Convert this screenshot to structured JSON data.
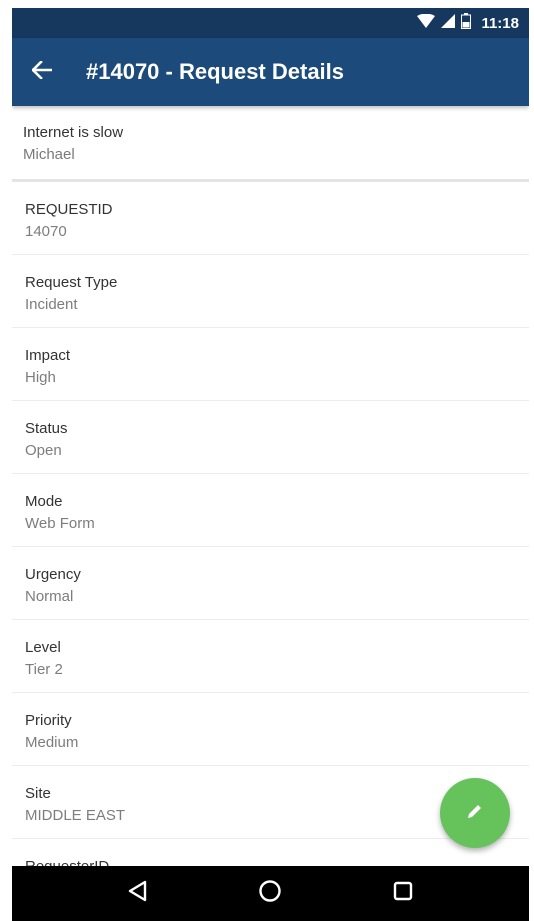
{
  "status_bar": {
    "time": "11:18",
    "icons": [
      "wifi-icon",
      "signal-icon",
      "battery-icon"
    ]
  },
  "app_bar": {
    "title": "#14070 - Request Details",
    "back_icon": "arrow-left-icon"
  },
  "summary": {
    "subject": "Internet is slow",
    "requester": "Michael"
  },
  "fields": [
    {
      "label": "REQUESTID",
      "value": "14070"
    },
    {
      "label": "Request Type",
      "value": "Incident"
    },
    {
      "label": "Impact",
      "value": "High"
    },
    {
      "label": "Status",
      "value": "Open"
    },
    {
      "label": "Mode",
      "value": "Web Form"
    },
    {
      "label": "Urgency",
      "value": "Normal"
    },
    {
      "label": "Level",
      "value": "Tier 2"
    },
    {
      "label": "Priority",
      "value": "Medium"
    },
    {
      "label": "Site",
      "value": "MIDDLE EAST"
    },
    {
      "label": "RequesterID",
      "value": ""
    }
  ],
  "fab": {
    "icon": "pencil-icon"
  },
  "nav_bar": {
    "icons": [
      "back-triangle-icon",
      "home-circle-icon",
      "recents-square-icon"
    ]
  },
  "colors": {
    "status_bar": "#16385f",
    "app_bar": "#1c4a7a",
    "fab": "#66c25b"
  }
}
